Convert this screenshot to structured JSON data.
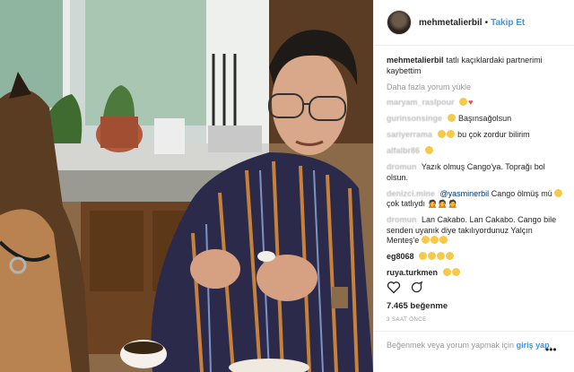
{
  "header": {
    "username": "mehmetalierbil",
    "separator": "•",
    "follow_label": "Takip Et"
  },
  "caption": {
    "username": "mehmetalierbil",
    "text": "tatlı kaçıklardaki partnerimi kaybettim"
  },
  "load_more": "Daha fazla yorum yükle",
  "comments": [
    {
      "user": "maryam_raslpour",
      "text": "",
      "emoji": [
        "crying-face-emoji",
        "red-heart-emoji"
      ]
    },
    {
      "user": "gurinsonsinge",
      "text": "Başınsağolsun",
      "emoji": [
        "sad-face-emoji"
      ]
    },
    {
      "user": "sariyerrama",
      "text": "bu çok zordur bilirim",
      "emoji": [
        "sad-face-emoji",
        "sad-face-emoji"
      ]
    },
    {
      "user": "alfalbr86",
      "text": "",
      "emoji": [
        "sad-face-emoji"
      ]
    },
    {
      "user": "dromun",
      "text": "Yazık olmuş Cango'ya. Toprağı bol olsun.",
      "emoji": []
    },
    {
      "user": "denizci.mine",
      "mention": "@yasminerbil",
      "text": "Cango ölmüş mü",
      "text2": "çok tatlıydı",
      "emoji": [
        "sad-face-emoji",
        "woman-emoji",
        "woman-emoji",
        "woman-emoji"
      ]
    },
    {
      "user": "dromun",
      "text": "Lan Cakabo. Lan Cakabo. Cango bile senden uyanık diye takılıyordunuz Yalçın Menteş'e",
      "emoji": [
        "smile-emoji",
        "smile-emoji",
        "smile-emoji"
      ]
    },
    {
      "user": "eg8068",
      "text": "",
      "emoji": [
        "sad-face-emoji",
        "sad-face-emoji",
        "sad-face-emoji",
        "sad-face-emoji"
      ]
    },
    {
      "user": "ruya.turkmen",
      "text": "",
      "emoji": [
        "sad-face-emoji",
        "sad-face-emoji"
      ]
    }
  ],
  "actions": {
    "like_icon": "heart-icon",
    "comment_icon": "comment-icon"
  },
  "likes": "7.465 beğenme",
  "timestamp": "3 SAAT ÖNCE",
  "login_prompt": {
    "text": "Beğenmek veya yorum yapmak için",
    "link": "giriş yap",
    "suffix": "."
  },
  "more_options": "•••"
}
